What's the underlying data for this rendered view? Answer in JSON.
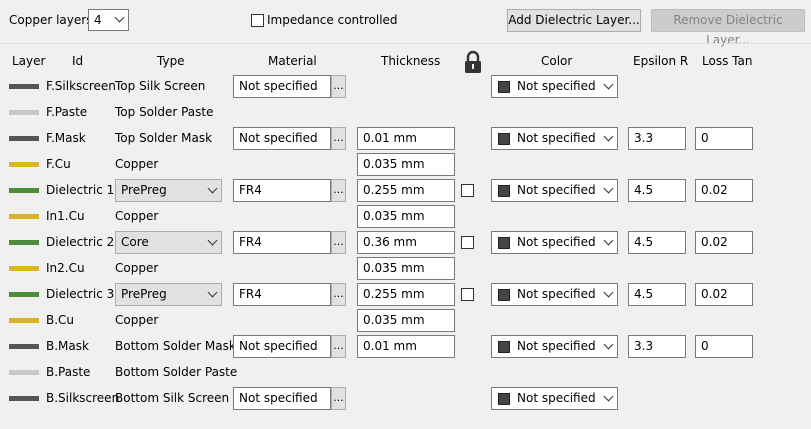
{
  "toolbar": {
    "copper_layers_label": "Copper layers:",
    "copper_layers_value": "4",
    "impedance_label": "Impedance controlled",
    "add_button": "Add Dielectric Layer...",
    "remove_button": "Remove Dielectric Layer..."
  },
  "headers": {
    "layer": "Layer",
    "id": "Id",
    "type": "Type",
    "material": "Material",
    "thickness": "Thickness",
    "color": "Color",
    "epsilon": "Epsilon R",
    "loss": "Loss Tan"
  },
  "colors": {
    "dark": "#555555",
    "light": "#c8c8c8",
    "copper": "#d9b523",
    "dielectric": "#4e8a3c"
  },
  "rows": [
    {
      "id": "F.Silkscreen",
      "swatch": "dark",
      "type": "Top Silk Screen",
      "material": "Not specified",
      "thickness": "",
      "color": "Not specified",
      "epsilon": "",
      "loss": ""
    },
    {
      "id": "F.Paste",
      "swatch": "light",
      "type": "Top Solder Paste",
      "material": "",
      "thickness": "",
      "color": "",
      "epsilon": "",
      "loss": ""
    },
    {
      "id": "F.Mask",
      "swatch": "dark",
      "type": "Top Solder Mask",
      "material": "Not specified",
      "thickness": "0.01 mm",
      "color": "Not specified",
      "epsilon": "3.3",
      "loss": "0"
    },
    {
      "id": "F.Cu",
      "swatch": "copper",
      "type": "Copper",
      "material": "",
      "thickness": "0.035 mm",
      "color": "",
      "epsilon": "",
      "loss": ""
    },
    {
      "id": "Dielectric 1",
      "swatch": "dielectric",
      "type": "PrePreg",
      "material": "FR4",
      "thickness": "0.255 mm",
      "color": "Not specified",
      "epsilon": "4.5",
      "loss": "0.02"
    },
    {
      "id": "In1.Cu",
      "swatch": "copper",
      "type": "Copper",
      "material": "",
      "thickness": "0.035 mm",
      "color": "",
      "epsilon": "",
      "loss": ""
    },
    {
      "id": "Dielectric 2",
      "swatch": "dielectric",
      "type": "Core",
      "material": "FR4",
      "thickness": "0.36 mm",
      "color": "Not specified",
      "epsilon": "4.5",
      "loss": "0.02"
    },
    {
      "id": "In2.Cu",
      "swatch": "copper",
      "type": "Copper",
      "material": "",
      "thickness": "0.035 mm",
      "color": "",
      "epsilon": "",
      "loss": ""
    },
    {
      "id": "Dielectric 3",
      "swatch": "dielectric",
      "type": "PrePreg",
      "material": "FR4",
      "thickness": "0.255 mm",
      "color": "Not specified",
      "epsilon": "4.5",
      "loss": "0.02"
    },
    {
      "id": "B.Cu",
      "swatch": "copper",
      "type": "Copper",
      "material": "",
      "thickness": "0.035 mm",
      "color": "",
      "epsilon": "",
      "loss": ""
    },
    {
      "id": "B.Mask",
      "swatch": "dark",
      "type": "Bottom Solder Mask",
      "material": "Not specified",
      "thickness": "0.01 mm",
      "color": "Not specified",
      "epsilon": "3.3",
      "loss": "0"
    },
    {
      "id": "B.Paste",
      "swatch": "light",
      "type": "Bottom Solder Paste",
      "material": "",
      "thickness": "",
      "color": "",
      "epsilon": "",
      "loss": ""
    },
    {
      "id": "B.Silkscreen",
      "swatch": "dark",
      "type": "Bottom Silk Screen",
      "material": "Not specified",
      "thickness": "",
      "color": "Not specified",
      "epsilon": "",
      "loss": ""
    }
  ],
  "icons": {
    "lock": "lock-icon",
    "dropdown": "chevron-down-icon"
  }
}
